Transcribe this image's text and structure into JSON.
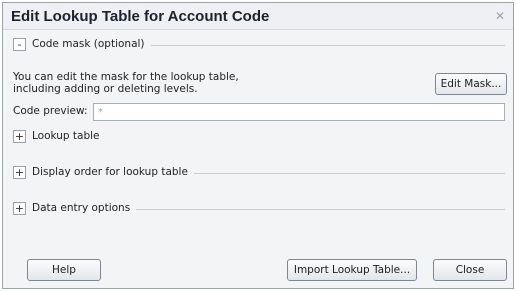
{
  "window": {
    "title": "Edit Lookup Table for Account Code",
    "close_glyph": "✕"
  },
  "sections": {
    "code_mask": {
      "toggle": "-",
      "label": "Code mask (optional)"
    },
    "lookup_table": {
      "toggle": "+",
      "label": "Lookup table"
    },
    "display_order": {
      "toggle": "+",
      "label": "Display order for lookup table"
    },
    "data_entry": {
      "toggle": "+",
      "label": "Data entry options"
    }
  },
  "code_mask": {
    "description_line1": "You can edit the mask for the lookup table,",
    "description_line2": "including adding or deleting levels.",
    "edit_mask_button": "Edit Mask...",
    "preview_label": "Code preview:",
    "preview_value": "*"
  },
  "footer": {
    "help_button": "Help",
    "import_button": "Import Lookup Table...",
    "close_button": "Close"
  }
}
